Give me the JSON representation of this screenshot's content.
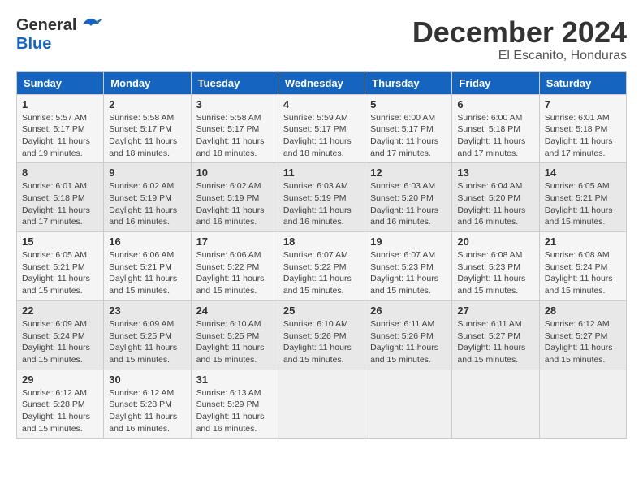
{
  "header": {
    "logo_general": "General",
    "logo_blue": "Blue",
    "title": "December 2024",
    "subtitle": "El Escanito, Honduras"
  },
  "calendar": {
    "days_of_week": [
      "Sunday",
      "Monday",
      "Tuesday",
      "Wednesday",
      "Thursday",
      "Friday",
      "Saturday"
    ],
    "weeks": [
      [
        {
          "day": "1",
          "sunrise": "5:57 AM",
          "sunset": "5:17 PM",
          "daylight": "11 hours and 19 minutes."
        },
        {
          "day": "2",
          "sunrise": "5:58 AM",
          "sunset": "5:17 PM",
          "daylight": "11 hours and 18 minutes."
        },
        {
          "day": "3",
          "sunrise": "5:58 AM",
          "sunset": "5:17 PM",
          "daylight": "11 hours and 18 minutes."
        },
        {
          "day": "4",
          "sunrise": "5:59 AM",
          "sunset": "5:17 PM",
          "daylight": "11 hours and 18 minutes."
        },
        {
          "day": "5",
          "sunrise": "6:00 AM",
          "sunset": "5:17 PM",
          "daylight": "11 hours and 17 minutes."
        },
        {
          "day": "6",
          "sunrise": "6:00 AM",
          "sunset": "5:18 PM",
          "daylight": "11 hours and 17 minutes."
        },
        {
          "day": "7",
          "sunrise": "6:01 AM",
          "sunset": "5:18 PM",
          "daylight": "11 hours and 17 minutes."
        }
      ],
      [
        {
          "day": "8",
          "sunrise": "6:01 AM",
          "sunset": "5:18 PM",
          "daylight": "11 hours and 17 minutes."
        },
        {
          "day": "9",
          "sunrise": "6:02 AM",
          "sunset": "5:19 PM",
          "daylight": "11 hours and 16 minutes."
        },
        {
          "day": "10",
          "sunrise": "6:02 AM",
          "sunset": "5:19 PM",
          "daylight": "11 hours and 16 minutes."
        },
        {
          "day": "11",
          "sunrise": "6:03 AM",
          "sunset": "5:19 PM",
          "daylight": "11 hours and 16 minutes."
        },
        {
          "day": "12",
          "sunrise": "6:03 AM",
          "sunset": "5:20 PM",
          "daylight": "11 hours and 16 minutes."
        },
        {
          "day": "13",
          "sunrise": "6:04 AM",
          "sunset": "5:20 PM",
          "daylight": "11 hours and 16 minutes."
        },
        {
          "day": "14",
          "sunrise": "6:05 AM",
          "sunset": "5:21 PM",
          "daylight": "11 hours and 15 minutes."
        }
      ],
      [
        {
          "day": "15",
          "sunrise": "6:05 AM",
          "sunset": "5:21 PM",
          "daylight": "11 hours and 15 minutes."
        },
        {
          "day": "16",
          "sunrise": "6:06 AM",
          "sunset": "5:21 PM",
          "daylight": "11 hours and 15 minutes."
        },
        {
          "day": "17",
          "sunrise": "6:06 AM",
          "sunset": "5:22 PM",
          "daylight": "11 hours and 15 minutes."
        },
        {
          "day": "18",
          "sunrise": "6:07 AM",
          "sunset": "5:22 PM",
          "daylight": "11 hours and 15 minutes."
        },
        {
          "day": "19",
          "sunrise": "6:07 AM",
          "sunset": "5:23 PM",
          "daylight": "11 hours and 15 minutes."
        },
        {
          "day": "20",
          "sunrise": "6:08 AM",
          "sunset": "5:23 PM",
          "daylight": "11 hours and 15 minutes."
        },
        {
          "day": "21",
          "sunrise": "6:08 AM",
          "sunset": "5:24 PM",
          "daylight": "11 hours and 15 minutes."
        }
      ],
      [
        {
          "day": "22",
          "sunrise": "6:09 AM",
          "sunset": "5:24 PM",
          "daylight": "11 hours and 15 minutes."
        },
        {
          "day": "23",
          "sunrise": "6:09 AM",
          "sunset": "5:25 PM",
          "daylight": "11 hours and 15 minutes."
        },
        {
          "day": "24",
          "sunrise": "6:10 AM",
          "sunset": "5:25 PM",
          "daylight": "11 hours and 15 minutes."
        },
        {
          "day": "25",
          "sunrise": "6:10 AM",
          "sunset": "5:26 PM",
          "daylight": "11 hours and 15 minutes."
        },
        {
          "day": "26",
          "sunrise": "6:11 AM",
          "sunset": "5:26 PM",
          "daylight": "11 hours and 15 minutes."
        },
        {
          "day": "27",
          "sunrise": "6:11 AM",
          "sunset": "5:27 PM",
          "daylight": "11 hours and 15 minutes."
        },
        {
          "day": "28",
          "sunrise": "6:12 AM",
          "sunset": "5:27 PM",
          "daylight": "11 hours and 15 minutes."
        }
      ],
      [
        {
          "day": "29",
          "sunrise": "6:12 AM",
          "sunset": "5:28 PM",
          "daylight": "11 hours and 15 minutes."
        },
        {
          "day": "30",
          "sunrise": "6:12 AM",
          "sunset": "5:28 PM",
          "daylight": "11 hours and 16 minutes."
        },
        {
          "day": "31",
          "sunrise": "6:13 AM",
          "sunset": "5:29 PM",
          "daylight": "11 hours and 16 minutes."
        },
        null,
        null,
        null,
        null
      ]
    ]
  }
}
